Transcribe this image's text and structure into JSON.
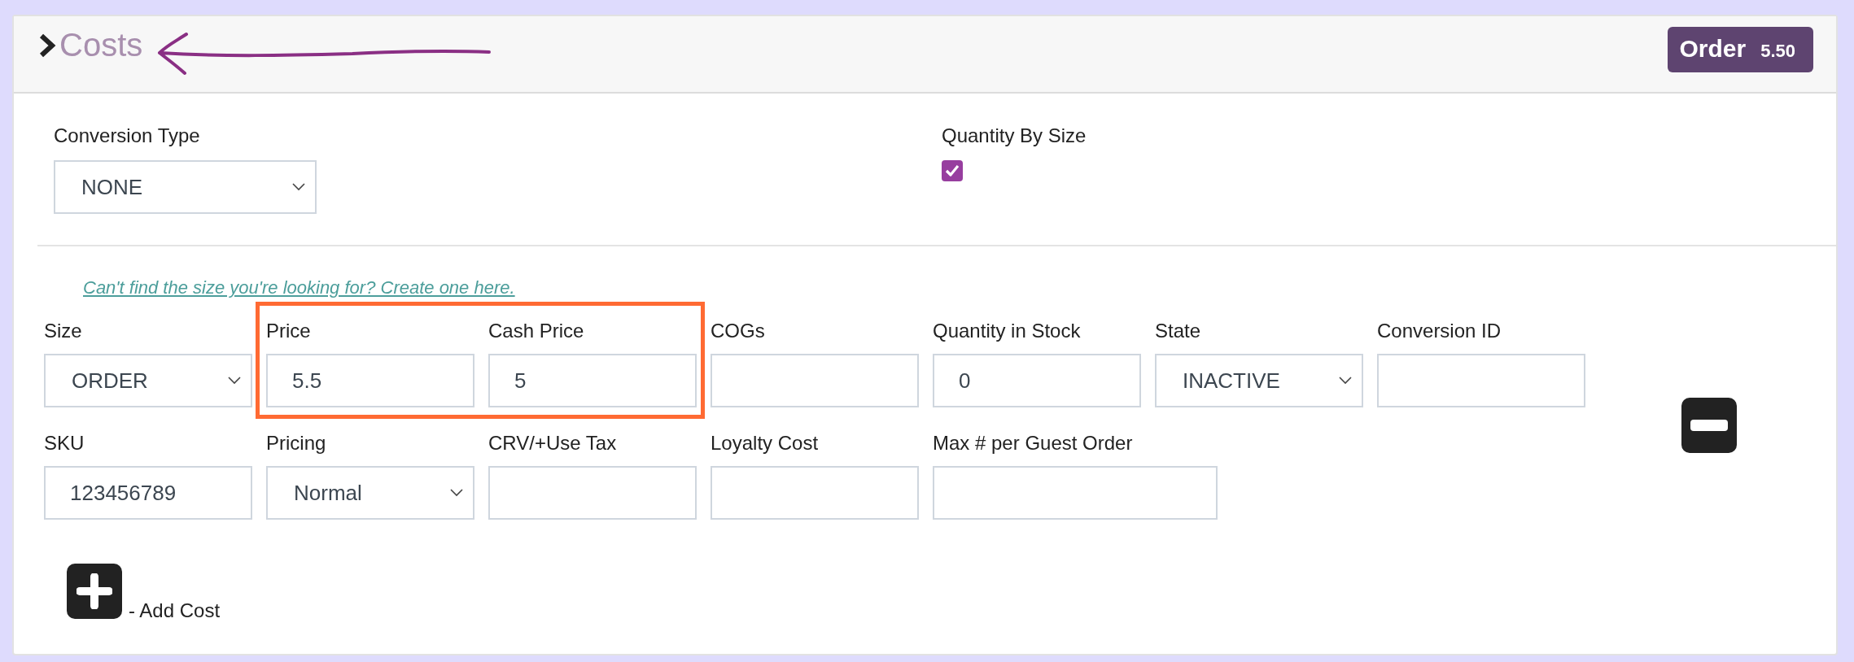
{
  "header": {
    "title": "Costs",
    "badge": {
      "label": "Order",
      "value": "5.50"
    }
  },
  "settings": [
    {
      "kind": "select",
      "label": "Conversion Type",
      "value": "NONE"
    },
    {
      "kind": "checkbox",
      "label": "Quantity By Size",
      "checked": true
    }
  ],
  "create_link": "Can't find the size you're looking for? Create one here.",
  "cost_rows": [
    [
      {
        "kind": "select",
        "label": "Size",
        "value": "ORDER",
        "highlighted": false
      },
      {
        "kind": "input",
        "label": "Price",
        "value": "5.5",
        "highlighted": true
      },
      {
        "kind": "input",
        "label": "Cash Price",
        "value": "5",
        "highlighted": true
      },
      {
        "kind": "input",
        "label": "COGs",
        "highlighted": false
      },
      {
        "kind": "input",
        "label": "Quantity in Stock",
        "value": "0",
        "highlighted": false
      },
      {
        "kind": "select",
        "label": "State",
        "value": "INACTIVE",
        "highlighted": false
      },
      {
        "kind": "input",
        "label": "Conversion ID",
        "highlighted": false
      }
    ],
    [
      {
        "kind": "input",
        "label": "SKU",
        "value": "123456789",
        "highlighted": false
      },
      {
        "kind": "select",
        "label": "Pricing",
        "value": "Normal",
        "highlighted": false
      },
      {
        "kind": "input",
        "label": "CRV/+Use Tax",
        "highlighted": false
      },
      {
        "kind": "input",
        "label": "Loyalty Cost",
        "highlighted": false
      },
      {
        "kind": "wide-input",
        "label": "Max # per Guest Order",
        "highlighted": false
      }
    ]
  ],
  "add_label": "- Add Cost"
}
